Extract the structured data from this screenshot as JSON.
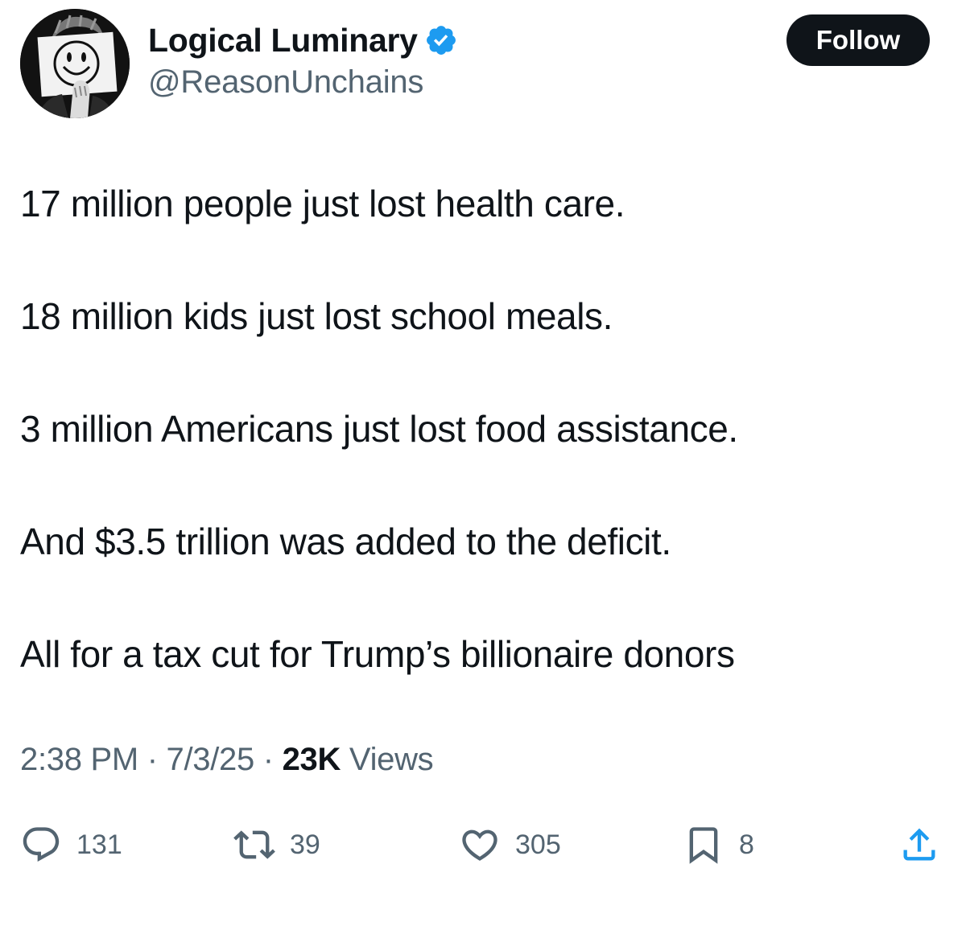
{
  "author": {
    "display_name": "Logical Luminary",
    "handle": "@ReasonUnchains",
    "verified": true,
    "avatar_icon": "smiley-face-sign-avatar"
  },
  "follow_button": {
    "label": "Follow"
  },
  "tweet": {
    "lines": [
      "17 million people just lost health care.",
      "18 million kids just lost school meals.",
      "3 million Americans just lost food assistance.",
      "And $3.5 trillion was added to the deficit.",
      "All for a tax cut for Trump’s billionaire donors"
    ]
  },
  "meta": {
    "time": "2:38 PM",
    "separator": " · ",
    "date": "7/3/25",
    "views_count": "23K",
    "views_label": " Views"
  },
  "actions": {
    "replies": "131",
    "reposts": "39",
    "likes": "305",
    "bookmarks": "8"
  },
  "colors": {
    "text_primary": "#0f1419",
    "text_secondary": "#536471",
    "verified_blue": "#1d9bf0",
    "follow_bg": "#0f1419"
  }
}
